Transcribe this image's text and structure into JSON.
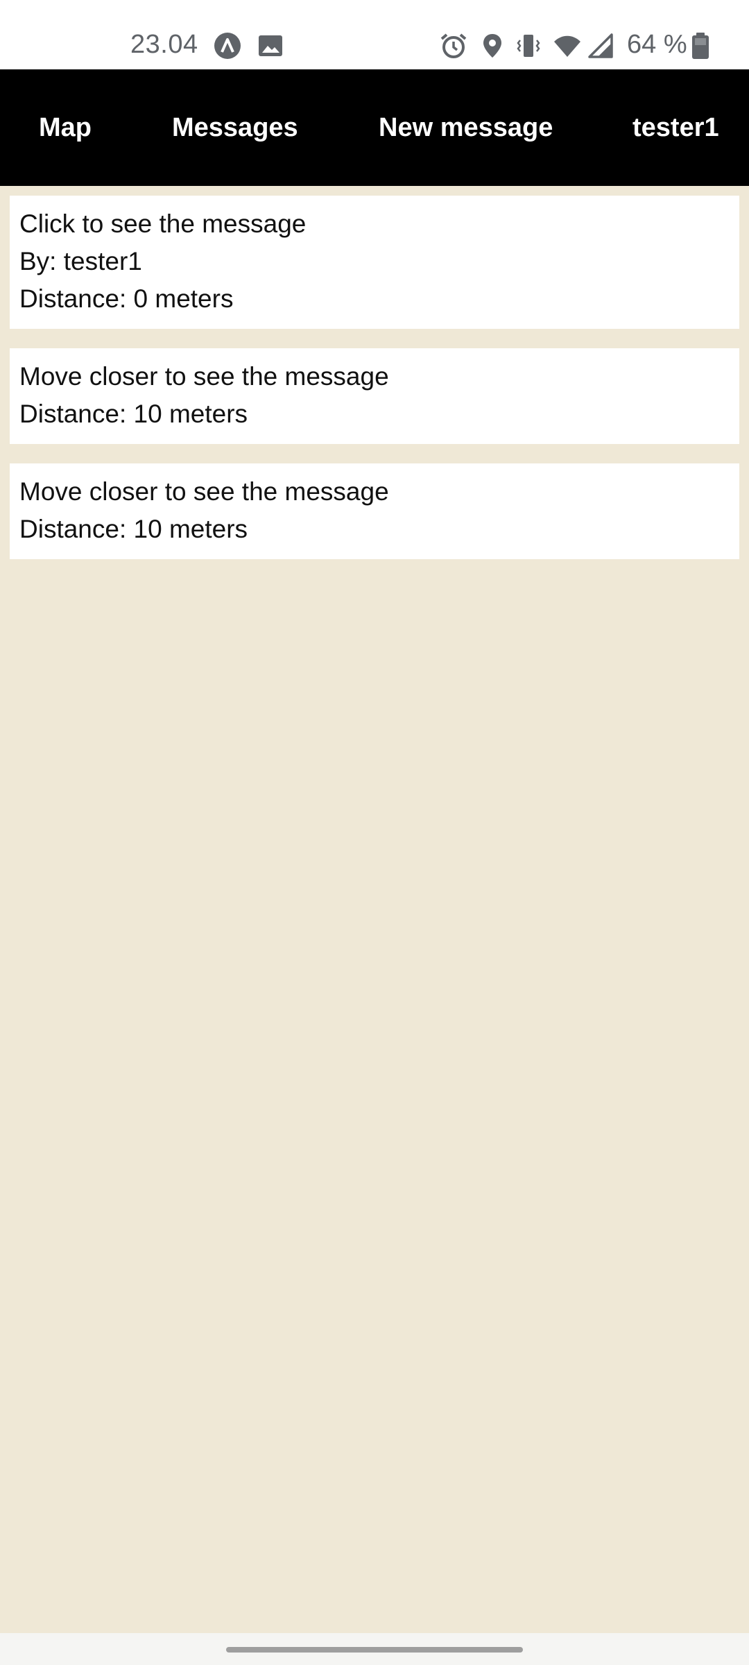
{
  "status_bar": {
    "time": "23.04",
    "battery_text": "64 %",
    "icons": [
      "app-notification-icon",
      "image-notification-icon",
      "alarm-icon",
      "location-icon",
      "vibrate-icon",
      "wifi-icon",
      "cell-signal-icon",
      "battery-icon"
    ]
  },
  "nav": {
    "map": "Map",
    "messages": "Messages",
    "new_message": "New message",
    "user": "tester1"
  },
  "messages": [
    {
      "title": "Click to see the message",
      "by": "By: tester1",
      "distance": "Distance: 0 meters"
    },
    {
      "title": "Move closer to see the message",
      "distance": "Distance: 10 meters"
    },
    {
      "title": "Move closer to see the message",
      "distance": "Distance: 10 meters"
    }
  ],
  "colors": {
    "background": "#efe8d6",
    "navbar": "#000000",
    "card": "#ffffff",
    "status_icons": "#5f6368"
  }
}
